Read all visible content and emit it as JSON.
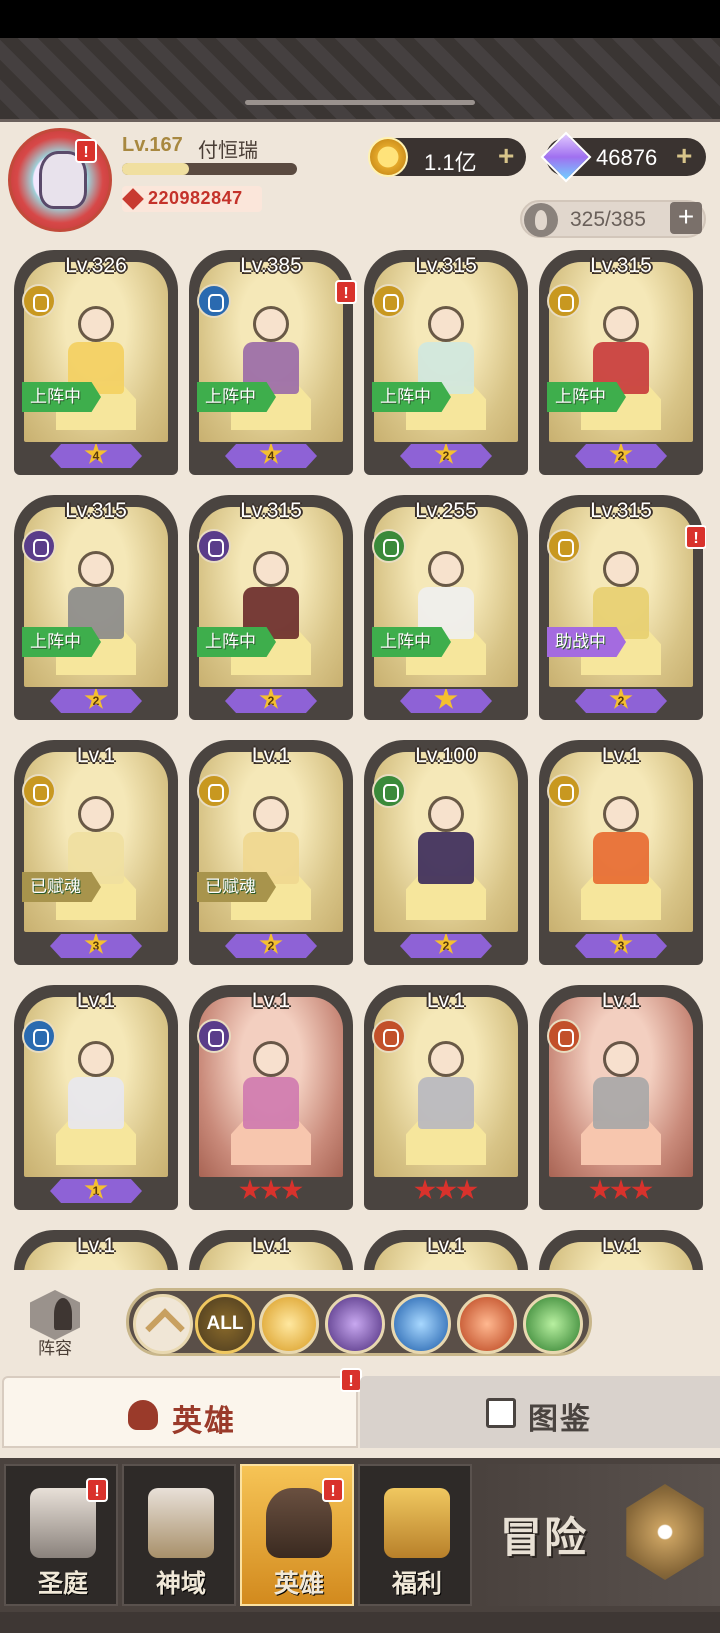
{
  "player": {
    "level": "Lv.167",
    "name": "付恒瑞",
    "power": "220982847",
    "exp_fraction": 0.38
  },
  "currency": {
    "gold": "1.1亿",
    "diamonds": "46876",
    "plus": "+"
  },
  "hero_slots": "325/385",
  "heroes": [
    {
      "level": "Lv.326",
      "faction": "light",
      "status": "上阵中",
      "stars": "4",
      "frame": "gold"
    },
    {
      "level": "Lv.385",
      "faction": "water",
      "status": "上阵中",
      "stars": "4",
      "frame": "gold",
      "alert": true
    },
    {
      "level": "Lv.315",
      "faction": "light",
      "status": "上阵中",
      "stars": "2",
      "frame": "gold"
    },
    {
      "level": "Lv.315",
      "faction": "light",
      "status": "上阵中",
      "stars": "2",
      "frame": "gold"
    },
    {
      "level": "Lv.315",
      "faction": "dark",
      "status": "上阵中",
      "stars": "2",
      "frame": "gold"
    },
    {
      "level": "Lv.315",
      "faction": "dark",
      "status": "上阵中",
      "stars": "2",
      "frame": "gold"
    },
    {
      "level": "Lv.255",
      "faction": "nature",
      "status": "上阵中",
      "stars": "",
      "frame": "gold"
    },
    {
      "level": "Lv.315",
      "faction": "light",
      "status": "助战中",
      "stars": "2",
      "frame": "gold",
      "alert": true
    },
    {
      "level": "Lv.1",
      "faction": "light",
      "status": "已赋魂",
      "stars": "3",
      "frame": "gold"
    },
    {
      "level": "Lv.1",
      "faction": "light",
      "status": "已赋魂",
      "stars": "2",
      "frame": "gold"
    },
    {
      "level": "Lv.100",
      "faction": "nature",
      "status": "",
      "stars": "2",
      "frame": "gold"
    },
    {
      "level": "Lv.1",
      "faction": "light",
      "status": "",
      "stars": "3",
      "frame": "gold"
    },
    {
      "level": "Lv.1",
      "faction": "water",
      "status": "",
      "stars": "1",
      "frame": "gold"
    },
    {
      "level": "Lv.1",
      "faction": "dark",
      "status": "",
      "stars": "red3",
      "frame": "red"
    },
    {
      "level": "Lv.1",
      "faction": "fire",
      "status": "",
      "stars": "red3",
      "frame": "gold"
    },
    {
      "level": "Lv.1",
      "faction": "fire",
      "status": "",
      "stars": "red3",
      "frame": "red"
    },
    {
      "level": "Lv.1",
      "faction": "",
      "status": "",
      "stars": "",
      "frame": "gold"
    },
    {
      "level": "Lv.1",
      "faction": "",
      "status": "",
      "stars": "",
      "frame": "gold"
    },
    {
      "level": "Lv.1",
      "faction": "",
      "status": "",
      "stars": "",
      "frame": "gold"
    },
    {
      "level": "Lv.1",
      "faction": "",
      "status": "",
      "stars": "",
      "frame": "gold"
    }
  ],
  "lineup_label": "阵容",
  "filters": {
    "all": "ALL"
  },
  "tabs": {
    "heroes": "英雄",
    "codex": "图鉴"
  },
  "nav": {
    "court": "圣庭",
    "divine": "神域",
    "heroes": "英雄",
    "welfare": "福利",
    "adventure": "冒险"
  }
}
